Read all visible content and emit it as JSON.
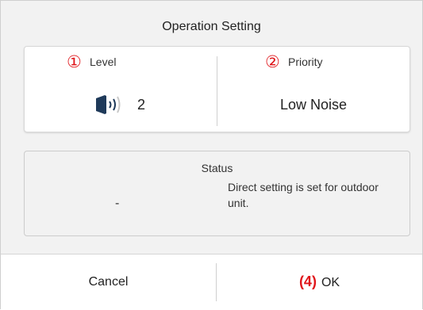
{
  "dialog": {
    "title": "Operation Setting"
  },
  "level": {
    "marker": "①",
    "label": "Level",
    "value": "2",
    "icon": "speaker-volume-icon"
  },
  "priority": {
    "marker": "②",
    "label": "Priority",
    "value": "Low Noise"
  },
  "status": {
    "label": "Status",
    "value": "-",
    "message": "Direct setting is set for outdoor unit."
  },
  "footer": {
    "cancel_label": "Cancel",
    "ok_marker": "(4)",
    "ok_label": "OK"
  },
  "colors": {
    "marker_red": "#e0161b",
    "background": "#f2f2f2",
    "card": "#ffffff"
  }
}
